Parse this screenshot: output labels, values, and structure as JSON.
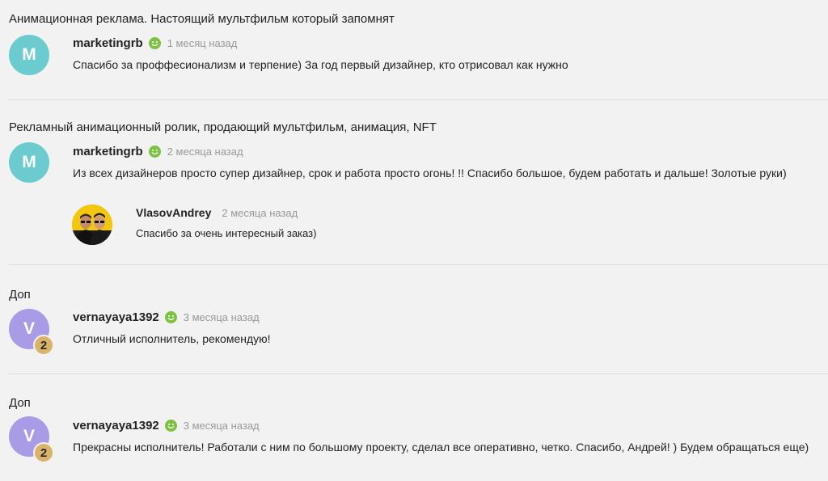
{
  "reviews": [
    {
      "title": "Анимационная реклама. Настоящий мультфильм который запомнят",
      "comment": {
        "avatar_letter": "M",
        "username": "marketingrb",
        "time": "1 месяц назад",
        "text": "Спасибо за проффесионализм и терпение) За год первый дизайнер, кто отрисовал как нужно"
      }
    },
    {
      "title": "Рекламный анимационный ролик, продающий мультфильм, анимация, NFT",
      "comment": {
        "avatar_letter": "M",
        "username": "marketingrb",
        "time": "2 месяца назад",
        "text": "Из всех дизайнеров просто супер дизайнер, срок и работа просто огонь! !! Спасибо большое, будем работать и дальше! Золотые руки)"
      },
      "reply": {
        "username": "VlasovAndrey",
        "time": "2 месяца назад",
        "text": "Спасибо за очень интересный заказ)"
      }
    },
    {
      "title": "Доп",
      "comment": {
        "avatar_letter": "V",
        "level": "2",
        "username": "vernayaya1392",
        "time": "3 месяца назад",
        "text": "Отличный исполнитель, рекомендую!"
      }
    },
    {
      "title": "Доп",
      "comment": {
        "avatar_letter": "V",
        "level": "2",
        "username": "vernayaya1392",
        "time": "3 месяца назад",
        "text": "Прекрасны исполнитель! Работали с ним по большому проекту, сделал все оперативно, четко. Спасибо, Андрей! ) Будем обращаться еще)"
      }
    }
  ],
  "colors": {
    "background": "#f2f2f2",
    "avatar_teal": "#6bcbcf",
    "avatar_purple": "#a99be6",
    "positive_smile": "#7cc142",
    "level_badge": "#d9b36a",
    "time_gray": "#999999"
  },
  "icons": {
    "positive_review": "smile-icon",
    "level": "level-badge"
  }
}
